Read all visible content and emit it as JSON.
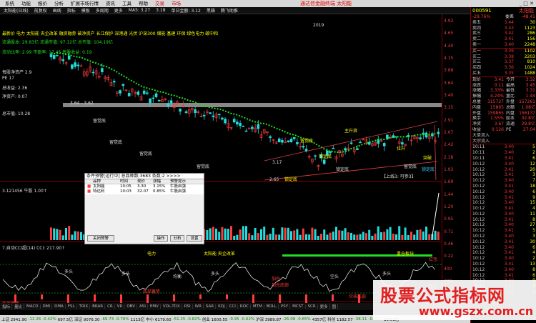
{
  "menu": {
    "items": [
      "系统",
      "功能",
      "报价",
      "分析",
      "扩展市场行情",
      "资讯",
      "工具",
      "帮助",
      "交易",
      "市场"
    ],
    "title": "通达信金融终端 太阳能"
  },
  "toolbar": {
    "items": [
      "太阳能(日线)",
      "前复权",
      "画线",
      "指标",
      "模板",
      "多周期",
      "更多"
    ],
    "ma_text": "MA5: 3.27",
    "ma_val": "3.18",
    "label_b": "单日金额: 3.12",
    "label_c": "黑箱",
    "label_d": "腾飞助推"
  },
  "overlay": {
    "l1": "最新价 电力 太阳能 央企改革 融资融券 破净资产 长江保护 深港通 光伏 沪深300 储能 基建 环保 绿色电力 碳中和",
    "l2": "流通股本: 29.83亿 流通市值: 97.12亿 总市值: 104.19亿",
    "l3": "流动比率: 2.99 市盈率: 17.45 每股收益: 0.19",
    "l4": "每股净资产 2.9",
    "l5": "PE 17",
    "l6": "总收益: 2.36",
    "l7": "净资产: 0.07",
    "l8": "总市值: 10.28"
  },
  "annotations": {
    "top_label": "3.64 - 3.62",
    "mark_2019": "2019",
    "label_mid": "3.17",
    "label_low": "2.65",
    "labels": [
      "留觉底",
      "留觉底",
      "留觉底",
      "留觉底",
      "锁定底",
      "留觉底",
      "锁定底",
      "主升浪",
      "锁定底",
      "拉升",
      "留觉底",
      "突破",
      "锁定底"
    ],
    "up_note": "【上线3: 可参3】",
    "indicator_title": "3.121456 牛股 1.00↑"
  },
  "dialog": {
    "title": "条件预警[运行中] 总品种数:3683 条数:2 >>>>",
    "cols": [
      "",
      "品种",
      "时间",
      "现价",
      "涨幅",
      "预警提示"
    ],
    "rows": [
      [
        "■",
        "太阳能",
        "10:05",
        "3.30",
        "3.15%",
        "牛股启强"
      ],
      [
        "■",
        "特达利",
        "10:03",
        "32.07",
        "0.85%",
        "牛股启强"
      ]
    ],
    "buttons": [
      "关闭预警",
      "操作",
      "分析",
      "设置"
    ]
  },
  "sub_indicator": {
    "title": "7.自动CCI超(14) CCI: 217.90↑",
    "labels": [
      "电力",
      "太阳能 央企改革",
      "重仓板块",
      "红宝",
      "多头",
      "多头",
      "多头",
      "多头",
      "均衡",
      "空头",
      "加仓",
      "底部蓄势",
      "加仓底部",
      "底部蓄势",
      "众核底部",
      "新起"
    ]
  },
  "right_axis": [
    "4.92",
    "4.65",
    "4.40",
    "4.15",
    "3.88",
    "3.64",
    "3.40",
    "3.15",
    "2.91",
    "2.67",
    "2.42",
    "2.18",
    "1.93",
    "1.69",
    "1.44",
    "1.20",
    "0.95",
    "0.71",
    "0.46",
    "0.22",
    "400",
    "300",
    "200",
    "100"
  ],
  "panel": {
    "code": "000591",
    "name": "太阳能",
    "change": "-29.76%",
    "ratio_label": "委差",
    "ratio": "-48.41",
    "asks": [
      [
        "卖五",
        "3.44",
        "30"
      ],
      [
        "卖四",
        "3.43",
        "1123"
      ],
      [
        "卖三",
        "3.42",
        "286"
      ],
      [
        "卖二",
        "3.41",
        "156"
      ],
      [
        "卖一",
        "3.40",
        "2248"
      ]
    ],
    "bids": [
      [
        "买一",
        "3.39",
        "1102"
      ],
      [
        "买二",
        "3.38",
        "2203"
      ],
      [
        "买三",
        "3.37",
        "810"
      ],
      [
        "买四",
        "3.36",
        "1024"
      ],
      [
        "买五",
        "3.35",
        "1488"
      ]
    ],
    "stats": [
      [
        "现价",
        "3.41",
        "今开",
        "3.32"
      ],
      [
        "涨跌",
        "0.11",
        "最高",
        "3.45"
      ],
      [
        "涨幅",
        "3.33%",
        "最低",
        "3.31"
      ],
      [
        "振幅",
        "4.24%",
        "量比",
        "1.44"
      ],
      [
        "总量",
        "315727",
        "外盘",
        "157261"
      ],
      [
        "内盘",
        "15865",
        "总额",
        "1.08亿"
      ],
      [
        "外盘",
        "159865",
        "内盘",
        "156137"
      ],
      [
        "换手",
        "1.55%",
        "股本",
        "32.8亿"
      ],
      [
        "净资",
        "3.67",
        "流通",
        "29.8亿"
      ],
      [
        "收益",
        "0.126",
        "PE",
        "27.04"
      ]
    ],
    "flow": [
      "大单流入",
      "大宗流入"
    ],
    "ticks": [
      [
        "10:11",
        "3.40",
        "5"
      ],
      [
        "10:11",
        "3.40",
        "2"
      ],
      [
        "10:11",
        "3.41",
        "6"
      ],
      [
        "10:12",
        "3.40",
        "12"
      ],
      [
        "10:12",
        "3.41",
        "20"
      ],
      [
        "10:12",
        "3.41",
        "3"
      ],
      [
        "10:12",
        "3.40",
        "7"
      ],
      [
        "10:12",
        "3.41",
        "18"
      ],
      [
        "10:12",
        "3.40",
        "6"
      ],
      [
        "10:12",
        "3.41",
        "9"
      ],
      [
        "10:12",
        "3.40",
        "15"
      ],
      [
        "10:12",
        "3.41",
        "4"
      ],
      [
        "10:12",
        "3.40",
        "11"
      ],
      [
        "10:12",
        "3.41",
        "8"
      ],
      [
        "10:12",
        "3.40",
        "27"
      ],
      [
        "10:12",
        "3.41",
        "5"
      ],
      [
        "10:12",
        "3.40",
        "3"
      ],
      [
        "10:12",
        "3.41",
        "30"
      ],
      [
        "10:12",
        "3.40",
        "6"
      ],
      [
        "10:12",
        "3.41",
        "4"
      ],
      [
        "10:12",
        "3.40",
        "2"
      ],
      [
        "10:12",
        "3.41",
        "13"
      ],
      [
        "10:12",
        "3.40",
        "8"
      ],
      [
        "10:12",
        "3.41",
        "6"
      ],
      [
        "10:12",
        "3.40",
        "9"
      ],
      [
        "10:12",
        "3.41",
        "5"
      ],
      [
        "10:12",
        "3.40",
        "7"
      ]
    ]
  },
  "tabs": [
    "指标",
    "量比",
    "MACD",
    "DMI",
    "DMA",
    "FSL",
    "TRIX",
    "BRAR",
    "CR",
    "VR",
    "OBV",
    "ASI",
    "EMV",
    "VOL-TDX",
    "RSI",
    "WR",
    "SAR",
    "KDJ",
    "CCI",
    "ROC",
    "MTM",
    "BOLL",
    "PSY",
    "MCST",
    "SCR",
    "更多",
    "图"
  ],
  "status": [
    "上证 2941.90",
    "-12.26",
    "-0.42%",
    "697.5亿",
    "深证 9076.30",
    "-69.73",
    "-0.76%",
    "1113亿",
    "中小 6179.60",
    "-51.25",
    "-0.82%",
    "创业 1600.55",
    "-9.95",
    "-0.62%",
    "沪深 3989.87",
    "-26.08",
    "-0.65%",
    "4357亿",
    "科创 1182.57",
    "-38.11",
    "-0.36%",
    "30.01亿"
  ],
  "watermark": {
    "line1": "股票公式指标网",
    "line2": "www.gszx.com.cn"
  },
  "colors": {
    "up": "#ff3b3b",
    "down": "#22dddd",
    "ma": "#22dd22",
    "accent": "#ff0"
  }
}
